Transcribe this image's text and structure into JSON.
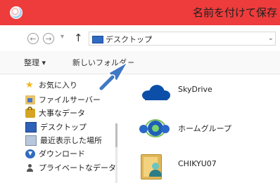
{
  "window": {
    "title": "名前を付けて保存",
    "colors": {
      "title_bar": "#ee3b3b",
      "accent": "#2f6bc2",
      "window_bg": "#ffffff"
    }
  },
  "address_bar": {
    "path_label": "デスクトップ",
    "back_icon": "back-arrow-icon",
    "forward_icon": "forward-arrow-icon",
    "up_icon": "up-arrow-icon"
  },
  "toolbar": {
    "organize_label": "整理 ▾",
    "new_folder_label": "新しいフォルダー"
  },
  "sidebar": {
    "items": [
      {
        "label": "お気に入り",
        "icon": "star-icon"
      },
      {
        "label": "ファイルサーバー",
        "icon": "server-folder-icon"
      },
      {
        "label": "大事なデータ",
        "icon": "lock-icon"
      },
      {
        "label": "デスクトップ",
        "icon": "desktop-icon"
      },
      {
        "label": "最近表示した場所",
        "icon": "recent-places-icon"
      },
      {
        "label": "ダウンロード",
        "icon": "download-icon"
      },
      {
        "label": "プライベートなデータ",
        "icon": "person-icon"
      }
    ]
  },
  "content": {
    "items": [
      {
        "label": "SkyDrive",
        "icon": "skydrive-icon"
      },
      {
        "label": "ホームグループ",
        "icon": "homegroup-icon"
      },
      {
        "label": "CHIKYU07",
        "icon": "user-folder-icon"
      }
    ]
  },
  "annotation": {
    "arrow_color": "#3f78c4",
    "arrow_icon": "pointer-arrow-icon"
  }
}
